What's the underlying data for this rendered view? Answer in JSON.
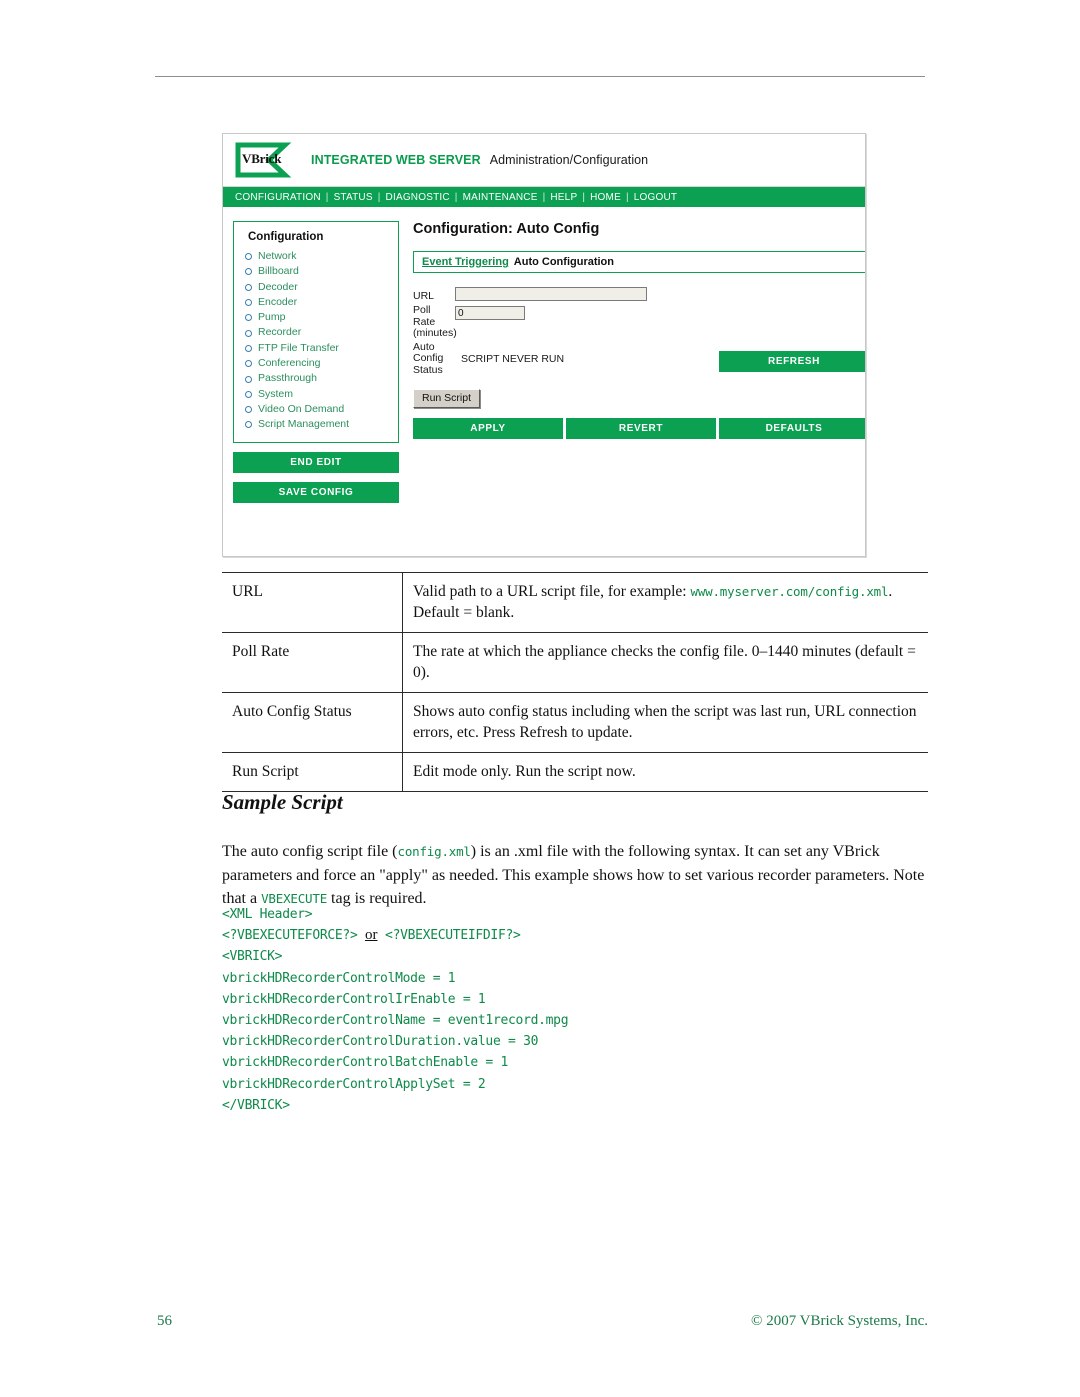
{
  "page": {
    "number": "56",
    "copyright": "© 2007 VBrick Systems, Inc."
  },
  "screenshot": {
    "logo_text": "VBrick",
    "header_title": "INTEGRATED WEB SERVER",
    "header_subtitle": "Administration/Configuration",
    "nav_items": [
      "CONFIGURATION",
      "STATUS",
      "DIAGNOSTIC",
      "MAINTENANCE",
      "HELP",
      "HOME",
      "LOGOUT"
    ],
    "sidebar": {
      "title": "Configuration",
      "items": [
        {
          "label": "Network"
        },
        {
          "label": "Billboard"
        },
        {
          "label": "Decoder"
        },
        {
          "label": "Encoder"
        },
        {
          "label": "Pump"
        },
        {
          "label": "Recorder"
        },
        {
          "label": "FTP File Transfer"
        },
        {
          "label": "Conferencing"
        },
        {
          "label": "Passthrough"
        },
        {
          "label": "System"
        },
        {
          "label": "Video On Demand"
        },
        {
          "label": "Script Management"
        }
      ],
      "end_edit_label": "END EDIT",
      "save_config_label": "SAVE CONFIG"
    },
    "panel": {
      "title": "Configuration: Auto Config",
      "tab_link": "Event Triggering",
      "tab_current": "Auto Configuration",
      "url_label": "URL",
      "url_value": "",
      "poll_label_line1": "Poll Rate",
      "poll_label_line2": "(minutes)",
      "poll_value": "0",
      "status_label_line1": "Auto",
      "status_label_line2": "Config",
      "status_label_line3": "Status",
      "status_value": "SCRIPT NEVER RUN",
      "refresh_label": "REFRESH",
      "run_script_label": "Run Script",
      "apply_label": "APPLY",
      "revert_label": "REVERT",
      "defaults_label": "DEFAULTS"
    }
  },
  "reference_table": {
    "rows": [
      {
        "term": "URL",
        "desc_pre": "Valid path to a URL script file, for example: ",
        "desc_code1": "www.myserver.com/",
        "desc_code2": "config.xml",
        "desc_post": ". Default  = blank."
      },
      {
        "term": "Poll Rate",
        "desc_pre": "The rate at which the appliance checks the config file. 0–1440 minutes (default = 0).",
        "desc_code1": "",
        "desc_code2": "",
        "desc_post": ""
      },
      {
        "term": "Auto Config Status",
        "desc_pre": "Shows auto config status including when the script was last run, URL connection errors, etc. Press Refresh to update.",
        "desc_code1": "",
        "desc_code2": "",
        "desc_post": ""
      },
      {
        "term": "Run Script",
        "desc_pre": "Edit mode only. Run the script now.",
        "desc_code1": "",
        "desc_code2": "",
        "desc_post": ""
      }
    ]
  },
  "sample_script": {
    "heading": "Sample Script",
    "para_1": "The auto config script file (",
    "para_code_1": "config.xml",
    "para_2": ") is an .xml file with the following syntax. It can set any VBrick parameters and force an \"apply\" as needed. This example shows how to set various recorder parameters. Note that a ",
    "para_code_2": "VBEXECUTE",
    "para_3": " tag is required.",
    "code_lines": [
      "<XML Header>",
      "<VBRICK>",
      "vbrickHDRecorderControlMode = 1",
      "vbrickHDRecorderControlIrEnable = 1",
      "vbrickHDRecorderControlName = event1record.mpg",
      "vbrickHDRecorderControlDuration.value = 30",
      "vbrickHDRecorderControlBatchEnable = 1",
      "vbrickHDRecorderControlApplySet = 2",
      "</VBRICK>"
    ],
    "force_line_a": "<?VBEXECUTEFORCE?>",
    "force_line_or": "or",
    "force_line_b": "<?VBEXECUTEIFDIF?>"
  }
}
